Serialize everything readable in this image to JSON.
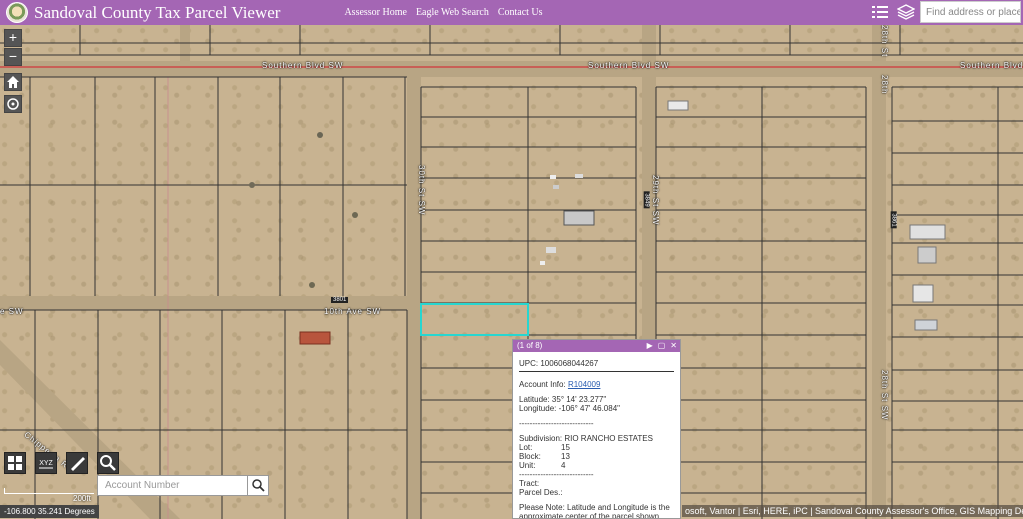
{
  "header": {
    "title": "Sandoval County Tax Parcel Viewer",
    "nav": [
      "Assessor Home",
      "Eagle Web Search",
      "Contact Us"
    ],
    "search_placeholder": "Find address or place"
  },
  "map": {
    "streets": {
      "southern_1": "Southern Blvd SW",
      "southern_2": "Southern Blvd SW",
      "southern_3": "Southern Blvd SW",
      "tenth_ave": "10th Ave SW",
      "ave_left": "e SW",
      "thirtieth": "30th St SW",
      "twentyninth": "29th St SW",
      "twentyeighth_top": "28th St",
      "twentyeighth_mid": "28th",
      "twentyeighth_bot": "28th St SW",
      "chippewa": "Chippewa Rd"
    },
    "badges": {
      "b1": "3801",
      "b2": "3849",
      "b3": "3861"
    },
    "controls": {
      "zoom_in": "+",
      "zoom_out": "−"
    }
  },
  "tools": {
    "xyz_label": "XYZ",
    "account_placeholder": "Account Number"
  },
  "scale_label": "200ft",
  "coords": "-106.800 35.241 Degrees",
  "attribution": "osoft, Vantor | Esri, HERE, iPC | Sandoval County Assessor's Office, GIS Mapping Department",
  "popup": {
    "counter": "(1 of 8)",
    "upc": "UPC: 1006068044267",
    "account_label": "Account Info:",
    "account_link": "R104009",
    "latitude": "Latitude: 35° 14' 23.277\"",
    "longitude": "Longitude: -106° 47' 46.084\"",
    "separator": "----------------------------",
    "subdivision": "Subdivision: RIO RANCHO ESTATES",
    "lot_label": "Lot:",
    "lot": "15",
    "block_label": "Block:",
    "block": "13",
    "unit_label": "Unit:",
    "unit": "4",
    "tract": "Tract:",
    "parcel_des": "Parcel Des.:",
    "note": "Please Note: Latitude and Longitude is the approximate center of the parcel shown"
  },
  "colors": {
    "brand": "#a466b4",
    "parcel_line": "#333333",
    "selection": "#27d6d0",
    "road_line": "#d2363b"
  }
}
